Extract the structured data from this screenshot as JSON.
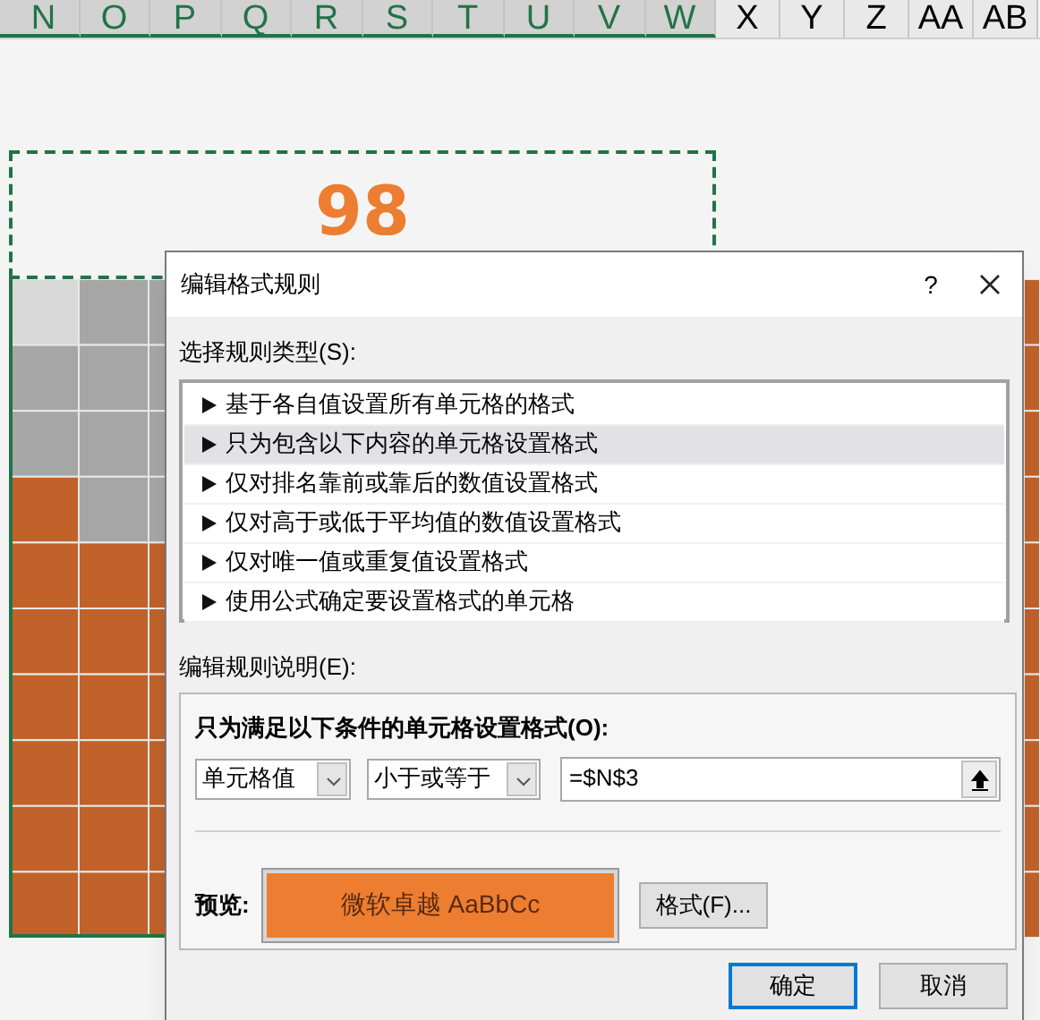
{
  "column_headers": [
    {
      "label": "N",
      "selected": true
    },
    {
      "label": "O",
      "selected": true
    },
    {
      "label": "P",
      "selected": true
    },
    {
      "label": "Q",
      "selected": true
    },
    {
      "label": "R",
      "selected": true
    },
    {
      "label": "S",
      "selected": true
    },
    {
      "label": "T",
      "selected": true
    },
    {
      "label": "U",
      "selected": true
    },
    {
      "label": "V",
      "selected": true
    },
    {
      "label": "W",
      "selected": true
    },
    {
      "label": "X",
      "selected": false
    },
    {
      "label": "Y",
      "selected": false
    },
    {
      "label": "Z",
      "selected": false
    },
    {
      "label": "AA",
      "selected": false
    },
    {
      "label": "AB",
      "selected": false
    }
  ],
  "sheet": {
    "shape_value": "98",
    "grid_rows": [
      {
        "left": [
          {
            "color": "#d9d9d9"
          },
          {
            "color": "#a6a6a6"
          },
          {
            "color": "#a6a6a6"
          }
        ],
        "right": {
          "color": "#c0622a"
        }
      },
      {
        "left": [
          {
            "color": "#a6a6a6"
          },
          {
            "color": "#a6a6a6"
          },
          {
            "color": "#a6a6a6"
          }
        ],
        "right": {
          "color": "#c0622a"
        }
      },
      {
        "left": [
          {
            "color": "#a6a6a6"
          },
          {
            "color": "#a6a6a6"
          },
          {
            "color": "#a6a6a6"
          }
        ],
        "right": {
          "color": "#c0622a"
        }
      },
      {
        "left": [
          {
            "color": "#c0622a"
          },
          {
            "color": "#a6a6a6"
          },
          {
            "color": "#a6a6a6"
          }
        ],
        "right": {
          "color": "#c0622a"
        }
      },
      {
        "left": [
          {
            "color": "#c0622a"
          },
          {
            "color": "#c0622a"
          },
          {
            "color": "#c0622a"
          }
        ],
        "right": {
          "color": "#c0622a"
        }
      },
      {
        "left": [
          {
            "color": "#c0622a"
          },
          {
            "color": "#c0622a"
          },
          {
            "color": "#c0622a"
          }
        ],
        "right": {
          "color": "#c0622a"
        }
      },
      {
        "left": [
          {
            "color": "#c0622a"
          },
          {
            "color": "#c0622a"
          },
          {
            "color": "#c0622a"
          }
        ],
        "right": {
          "color": "#c0622a"
        }
      },
      {
        "left": [
          {
            "color": "#c0622a"
          },
          {
            "color": "#c0622a"
          },
          {
            "color": "#c0622a"
          }
        ],
        "right": {
          "color": "#c0622a"
        }
      },
      {
        "left": [
          {
            "color": "#c0622a"
          },
          {
            "color": "#c0622a"
          },
          {
            "color": "#c0622a"
          }
        ],
        "right": {
          "color": "#c0622a"
        }
      },
      {
        "left": [
          {
            "color": "#c0622a"
          },
          {
            "color": "#c0622a"
          },
          {
            "color": "#c0622a"
          }
        ],
        "right": {
          "color": "#c0622a"
        }
      }
    ]
  },
  "dialog": {
    "title": "编辑格式规则",
    "help": "?",
    "rule_type_label": "选择规则类型(S):",
    "rule_types": [
      {
        "label": "基于各自值设置所有单元格的格式",
        "selected": false
      },
      {
        "label": "只为包含以下内容的单元格设置格式",
        "selected": true
      },
      {
        "label": "仅对排名靠前或靠后的数值设置格式",
        "selected": false
      },
      {
        "label": "仅对高于或低于平均值的数值设置格式",
        "selected": false
      },
      {
        "label": "仅对唯一值或重复值设置格式",
        "selected": false
      },
      {
        "label": "使用公式确定要设置格式的单元格",
        "selected": false
      }
    ],
    "description_label": "编辑规则说明(E):",
    "condition_heading": "只为满足以下条件的单元格设置格式(O):",
    "condition_field": "单元格值",
    "operator": "小于或等于",
    "value": "=$N$3",
    "preview_label": "预览:",
    "preview_text": "微软卓越 AaBbCc",
    "format_button": "格式(F)...",
    "buttons": [
      {
        "label": "确定",
        "default": true
      },
      {
        "label": "取消",
        "default": false
      }
    ]
  }
}
